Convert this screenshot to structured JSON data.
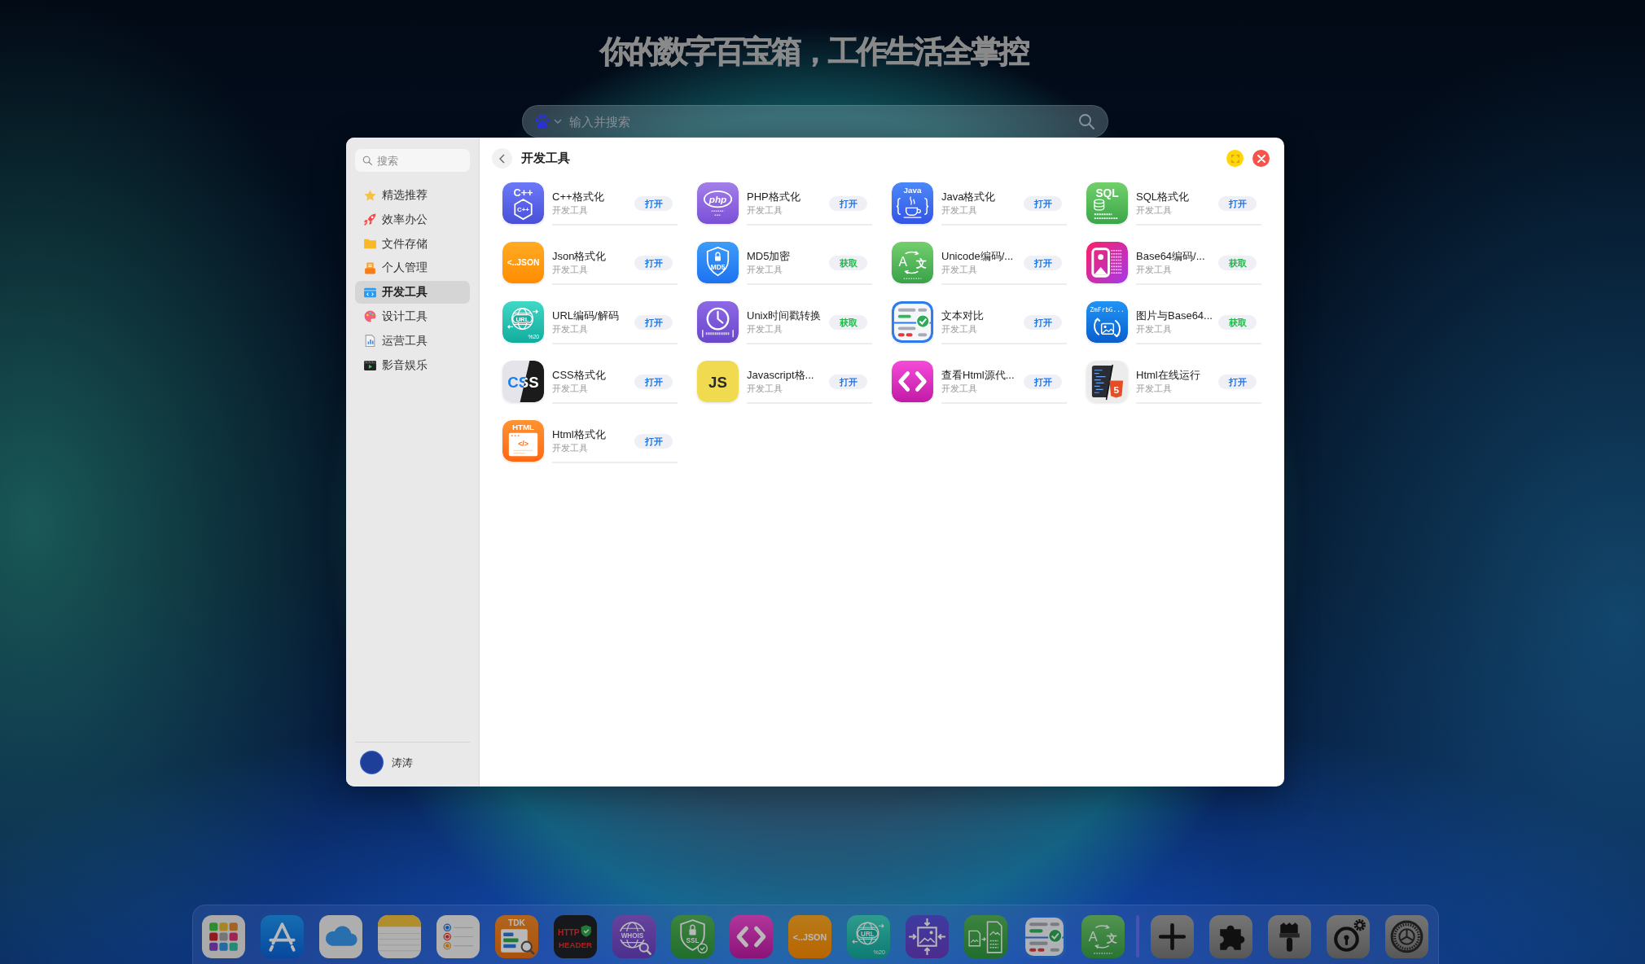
{
  "headline": "你的数字百宝箱，工作生活全掌控",
  "search": {
    "placeholder": "输入并搜索"
  },
  "window": {
    "sidebar": {
      "search": {
        "placeholder": "搜索"
      },
      "items": [
        {
          "label": "精选推荐",
          "selected": false
        },
        {
          "label": "效率办公",
          "selected": false
        },
        {
          "label": "文件存储",
          "selected": false
        },
        {
          "label": "个人管理",
          "selected": false
        },
        {
          "label": "开发工具",
          "selected": true
        },
        {
          "label": "设计工具",
          "selected": false
        },
        {
          "label": "运营工具",
          "selected": false
        },
        {
          "label": "影音娱乐",
          "selected": false
        }
      ],
      "user": {
        "name": "涛涛"
      }
    },
    "title": "开发工具",
    "apps": [
      {
        "name": "C++格式化",
        "category": "开发工具",
        "icon_text": [
          "C++",
          "C++"
        ],
        "button": "打开",
        "installed": true
      },
      {
        "name": "PHP格式化",
        "category": "开发工具",
        "icon_text": [
          "php"
        ],
        "button": "打开",
        "installed": true
      },
      {
        "name": "Java格式化",
        "category": "开发工具",
        "icon_text": [
          "Java"
        ],
        "button": "打开",
        "installed": true
      },
      {
        "name": "SQL格式化",
        "category": "开发工具",
        "icon_text": [
          "SQL"
        ],
        "button": "打开",
        "installed": true
      },
      {
        "name": "Json格式化",
        "category": "开发工具",
        "icon_text": [
          "<..JSON"
        ],
        "button": "打开",
        "installed": true
      },
      {
        "name": "MD5加密",
        "category": "开发工具",
        "icon_text": [
          "MD5"
        ],
        "button": "获取",
        "installed": false
      },
      {
        "name": "Unicode编码/...",
        "category": "开发工具",
        "icon_text": [
          "A",
          "文"
        ],
        "button": "打开",
        "installed": true
      },
      {
        "name": "Base64编码/...",
        "category": "开发工具",
        "button": "获取",
        "installed": false
      },
      {
        "name": "URL编码/解码",
        "category": "开发工具",
        "icon_text": [
          "URL",
          "%20"
        ],
        "button": "打开",
        "installed": true
      },
      {
        "name": "Unix时间戳转换",
        "category": "开发工具",
        "button": "获取",
        "installed": false
      },
      {
        "name": "文本对比",
        "category": "开发工具",
        "button": "打开",
        "installed": true
      },
      {
        "name": "图片与Base64...",
        "category": "开发工具",
        "icon_text": [
          "ZmFrbG..."
        ],
        "button": "获取",
        "installed": false
      },
      {
        "name": "CSS格式化",
        "category": "开发工具",
        "icon_text": [
          "CSS"
        ],
        "button": "打开",
        "installed": true
      },
      {
        "name": "Javascript格...",
        "category": "开发工具",
        "icon_text": [
          "JS"
        ],
        "button": "打开",
        "installed": true
      },
      {
        "name": "查看Html源代...",
        "category": "开发工具",
        "button": "打开",
        "installed": true
      },
      {
        "name": "Html在线运行",
        "category": "开发工具",
        "icon_text": [
          "5"
        ],
        "button": "打开",
        "installed": true
      },
      {
        "name": "Html格式化",
        "category": "开发工具",
        "icon_text": [
          "HTML",
          "</>"
        ],
        "button": "打开",
        "installed": true
      }
    ]
  },
  "dock": [
    {
      "kind": "app"
    },
    {
      "kind": "app"
    },
    {
      "kind": "app"
    },
    {
      "kind": "app"
    },
    {
      "kind": "app"
    },
    {
      "kind": "app",
      "icon_text": [
        "TDK"
      ]
    },
    {
      "kind": "app",
      "icon_text": [
        "HTTP",
        "HEADER"
      ]
    },
    {
      "kind": "app",
      "icon_text": [
        "WHOIS"
      ]
    },
    {
      "kind": "app",
      "icon_text": [
        "SSL"
      ]
    },
    {
      "kind": "app"
    },
    {
      "kind": "app",
      "icon_text": [
        "<..JSON"
      ]
    },
    {
      "kind": "app",
      "icon_text": [
        "URL",
        "%20"
      ]
    },
    {
      "kind": "app"
    },
    {
      "kind": "app"
    },
    {
      "kind": "app"
    },
    {
      "kind": "app",
      "icon_text": [
        "A",
        "文"
      ]
    },
    {
      "kind": "divider"
    },
    {
      "kind": "app"
    },
    {
      "kind": "app"
    },
    {
      "kind": "app"
    },
    {
      "kind": "app"
    },
    {
      "kind": "app"
    }
  ]
}
